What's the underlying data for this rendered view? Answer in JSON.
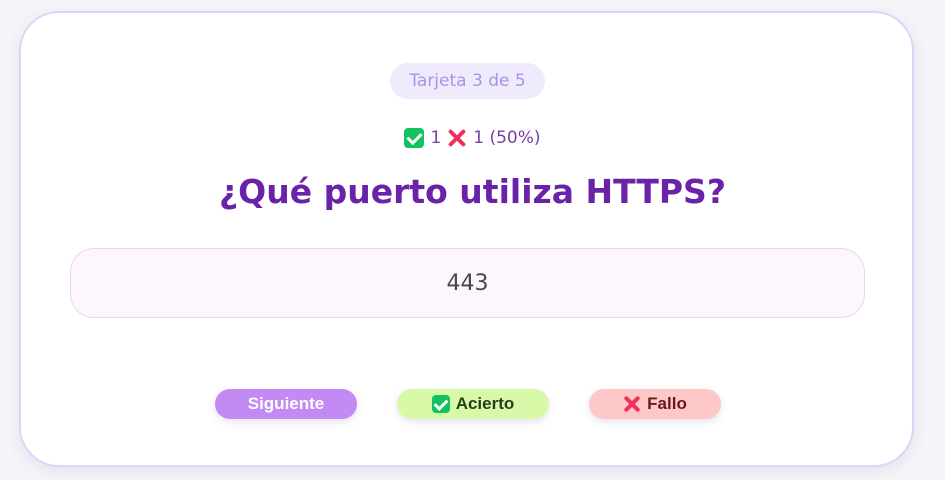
{
  "flashcard": {
    "counter": "Tarjeta 3 de 5",
    "score": {
      "correct_count": "1",
      "wrong_count": "1 (50%)"
    },
    "question": "¿Qué puerto utiliza HTTPS?",
    "answer": "443"
  },
  "actions": {
    "next_label": "Siguiente",
    "correct_label": "Acierto",
    "wrong_label": "Fallo"
  },
  "icons": {
    "correct": "check-icon",
    "wrong": "cross-icon"
  },
  "colors": {
    "accent": "#6a22a8",
    "next_button": "#c48af4",
    "correct_button": "#d8f9a8",
    "wrong_button": "#ffc8c8",
    "check_green": "#12c25f",
    "cross_red": "#f0305a"
  }
}
